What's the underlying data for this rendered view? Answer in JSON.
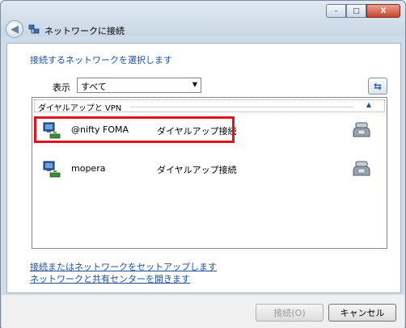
{
  "window": {
    "title": "ネットワークに接続",
    "controls": {
      "minimize": "–",
      "maximize": "□",
      "close": "X"
    }
  },
  "main": {
    "heading": "接続するネットワークを選択します",
    "show_label": "表示",
    "show_select_value": "すべて",
    "group": {
      "label": "ダイヤルアップと VPN"
    },
    "connections": [
      {
        "name": "@nifty FOMA",
        "type": "ダイヤルアップ接続",
        "selected": true
      },
      {
        "name": "mopera",
        "type": "ダイヤルアップ接続",
        "selected": false
      }
    ],
    "links": {
      "setup": "接続またはネットワークをセットアップします",
      "center": "ネットワークと共有センターを開きます"
    }
  },
  "footer": {
    "connect_label": "接続(O)",
    "cancel_label": "キャンセル"
  },
  "colors": {
    "highlight": "#e0141e",
    "link": "#1e4f9c"
  }
}
